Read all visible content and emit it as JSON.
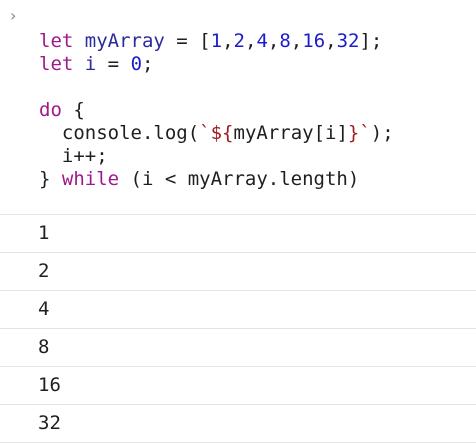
{
  "console": {
    "prompt_icon": "chevron-right-icon",
    "prompt_glyph": "›",
    "code": {
      "line1": {
        "kw": "let",
        "name": "myArray",
        "eq": " = [",
        "n1": "1",
        "c1": ",",
        "n2": "2",
        "c2": ",",
        "n3": "4",
        "c3": ",",
        "n4": "8",
        "c4": ",",
        "n5": "16",
        "c5": ",",
        "n6": "32",
        "end": "];"
      },
      "line2": {
        "kw": "let",
        "name": "i",
        "eq": " = ",
        "n": "0",
        "end": ";"
      },
      "line4": {
        "kw": "do",
        "rest": " {"
      },
      "line5": {
        "indent": "  ",
        "text": "console.log(",
        "str": "`${",
        "inner": "myArray[i]",
        "str2": "}`",
        "end": ");"
      },
      "line6": {
        "indent": "  ",
        "text": "i++;"
      },
      "line7": {
        "brace": "} ",
        "kw": "while",
        "rest": " (i < myArray.length)"
      }
    },
    "output": [
      "1",
      "2",
      "4",
      "8",
      "16",
      "32"
    ]
  }
}
